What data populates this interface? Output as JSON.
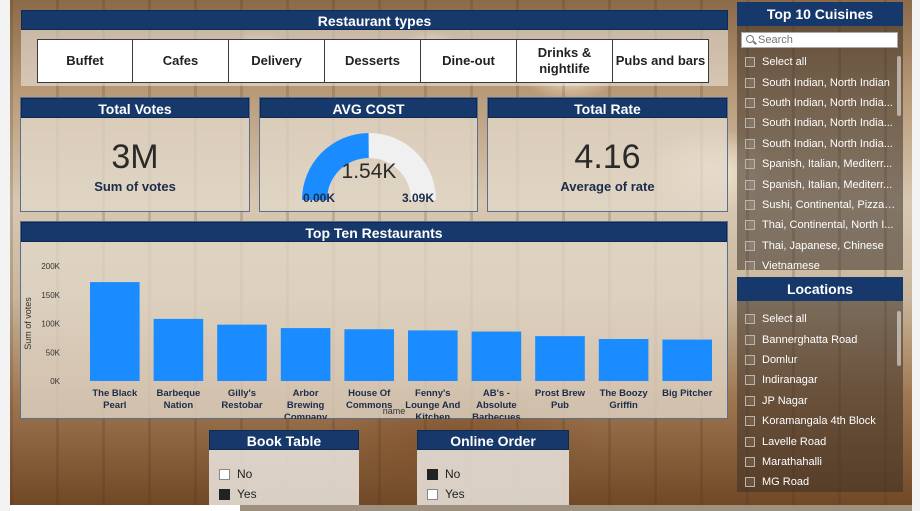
{
  "restaurant_types": {
    "title": "Restaurant types",
    "items": [
      "Buffet",
      "Cafes",
      "Delivery",
      "Desserts",
      "Dine-out",
      "Drinks & nightlife",
      "Pubs and bars"
    ]
  },
  "total_votes": {
    "title": "Total Votes",
    "value": "3M",
    "label": "Sum of votes"
  },
  "avg_cost": {
    "title": "AVG COST",
    "value": "1.54K",
    "min": "0.00K",
    "max": "3.09K",
    "fraction": 0.498
  },
  "total_rate": {
    "title": "Total Rate",
    "value": "4.16",
    "label": "Average of rate"
  },
  "chart_data": {
    "type": "bar",
    "title": "Top Ten Restaurants",
    "xlabel": "name",
    "ylabel": "Sum of votes",
    "ylim": [
      0,
      200000
    ],
    "yticks": [
      0,
      50000,
      100000,
      150000,
      200000
    ],
    "ytick_labels": [
      "0K",
      "50K",
      "100K",
      "150K",
      "200K"
    ],
    "categories": [
      "The Black Pearl",
      "Barbeque Nation",
      "Gilly's Restobar",
      "Arbor Brewing Company",
      "House Of Commons",
      "Fenny's Lounge And Kitchen",
      "AB's - Absolute Barbecues",
      "Prost Brew Pub",
      "The Boozy Griffin",
      "Big Pitcher"
    ],
    "values": [
      172000,
      108000,
      98000,
      92000,
      90000,
      88000,
      86000,
      78000,
      73000,
      72000
    ],
    "color": "#1a8cff"
  },
  "book_table": {
    "title": "Book Table",
    "options": [
      {
        "label": "No",
        "checked": false
      },
      {
        "label": "Yes",
        "checked": true
      }
    ]
  },
  "online_order": {
    "title": "Online Order",
    "options": [
      {
        "label": "No",
        "checked": true
      },
      {
        "label": "Yes",
        "checked": false
      }
    ]
  },
  "cuisines": {
    "title": "Top 10 Cuisines",
    "search_placeholder": "Search",
    "items": [
      "Select all",
      "South Indian, North Indian",
      "South Indian, North India...",
      "South Indian, North India...",
      "South Indian, North India...",
      "Spanish, Italian, Mediterr...",
      "Spanish, Italian, Mediterr...",
      "Sushi, Continental, Pizza, ...",
      "Thai, Continental, North I...",
      "Thai, Japanese, Chinese",
      "Vietnamese"
    ]
  },
  "locations": {
    "title": "Locations",
    "items": [
      "Select all",
      "Bannerghatta Road",
      "Domlur",
      "Indiranagar",
      "JP Nagar",
      "Koramangala 4th Block",
      "Lavelle Road",
      "Marathahalli",
      "MG Road"
    ]
  }
}
